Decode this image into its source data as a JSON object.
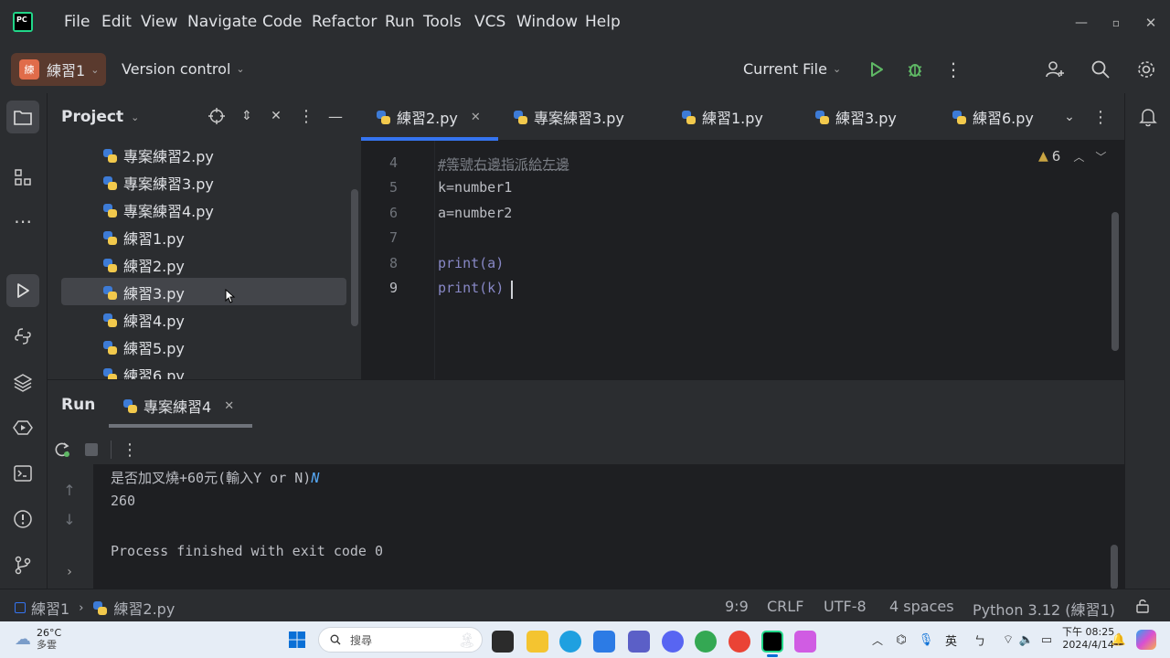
{
  "menubar": {
    "logo": "PC",
    "items": [
      "File",
      "Edit",
      "View",
      "Navigate",
      "Code",
      "Refactor",
      "Run",
      "Tools",
      "VCS",
      "Window",
      "Help"
    ]
  },
  "toolbar": {
    "project_badge": "練",
    "project_name": "練習1",
    "vcs_label": "Version control",
    "run_config": "Current File"
  },
  "project_panel": {
    "title": "Project",
    "files": [
      "專案練習2.py",
      "專案練習3.py",
      "專案練習4.py",
      "練習1.py",
      "練習2.py",
      "練習3.py",
      "練習4.py",
      "練習5.py",
      "練習6.py"
    ],
    "selected_index": 5
  },
  "editor": {
    "tabs": [
      "練習2.py",
      "專案練習3.py",
      "練習1.py",
      "練習3.py",
      "練習6.py"
    ],
    "active_tab": 0,
    "warning_count": "6",
    "lines": [
      {
        "num": "4",
        "text": "#等號右邊指派給左邊"
      },
      {
        "num": "5",
        "text": "k=number1"
      },
      {
        "num": "6",
        "text": "a=number2"
      },
      {
        "num": "7",
        "text": ""
      },
      {
        "num": "8",
        "text": "print(a)"
      },
      {
        "num": "9",
        "text": "print(k)"
      }
    ]
  },
  "run_panel": {
    "title": "Run",
    "tab_label": "專案練習4",
    "output": {
      "prompt": "是否加叉燒+60元(輸入Y or N)",
      "input": "N",
      "result": "260",
      "finished": "Process finished with exit code 0"
    }
  },
  "statusbar": {
    "crumb_project": "練習1",
    "crumb_file": "練習2.py",
    "position": "9:9",
    "line_sep": "CRLF",
    "encoding": "UTF-8",
    "indent": "4 spaces",
    "interpreter": "Python 3.12 (練習1)"
  },
  "taskbar": {
    "weather_temp": "26°C",
    "weather_desc": "多雲",
    "search_placeholder": "搜尋",
    "ime": "英",
    "time": "下午 08:25",
    "date": "2024/4/14"
  },
  "colors": {
    "accent": "#3574f0",
    "run_green": "#5fb865",
    "keyword": "#56a8f5"
  }
}
